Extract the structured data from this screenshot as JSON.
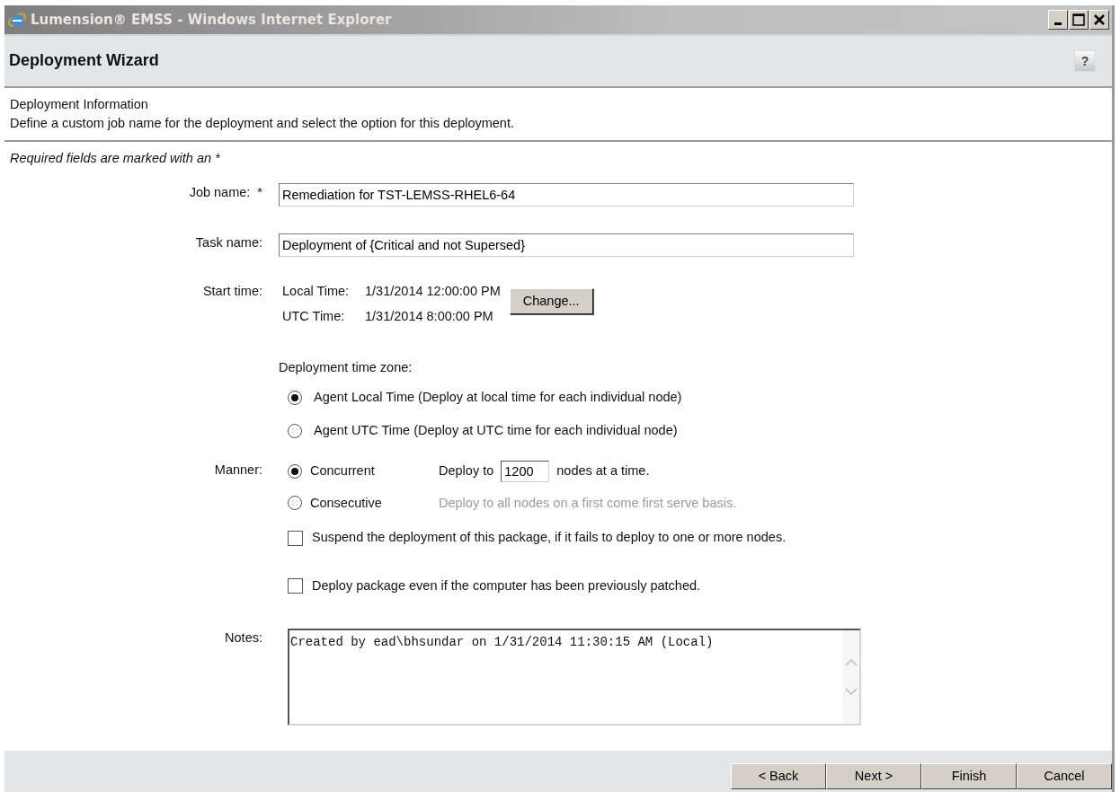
{
  "window": {
    "title": "Lumension® EMSS - Windows Internet Explorer"
  },
  "header": {
    "title": "Deployment Wizard",
    "help": "?"
  },
  "info": {
    "heading": "Deployment Information",
    "description": "Define a custom job name for the deployment and select the option for this deployment."
  },
  "required_note": "Required fields are marked with an *",
  "job_name": {
    "label": "Job name:",
    "required_mark": "*",
    "value": "Remediation for TST-LEMSS-RHEL6-64"
  },
  "task_name": {
    "label": "Task name:",
    "value": "Deployment of {Critical and not Supersed}"
  },
  "start_time": {
    "label": "Start time:",
    "local_label": "Local Time:",
    "local_value": "1/31/2014 12:00:00 PM",
    "utc_label": "UTC Time:",
    "utc_value": "1/31/2014 8:00:00 PM",
    "button": "Change..."
  },
  "time_zone": {
    "label": "Deployment time zone:",
    "options": [
      {
        "label": "Agent Local Time (Deploy at local time for each individual node)",
        "selected": true
      },
      {
        "label": "Agent UTC Time (Deploy at UTC time for each individual node)",
        "selected": false
      }
    ]
  },
  "manner": {
    "label": "Manner:",
    "options": [
      {
        "label": "Concurrent",
        "selected": true,
        "kind": "count",
        "prefix": "Deploy to",
        "value": "1200",
        "suffix": "nodes at a time."
      },
      {
        "label": "Consecutive",
        "selected": false,
        "kind": "text",
        "description": "Deploy to all nodes on a first come first serve basis."
      }
    ]
  },
  "options": [
    {
      "label": "Suspend the deployment of this package, if it fails to deploy to one or more nodes.",
      "checked": false
    },
    {
      "label": "Deploy package even if the computer has been previously patched.",
      "checked": false
    }
  ],
  "notes": {
    "label": "Notes:",
    "value": "Created by ead\\bhsundar on 1/31/2014 11:30:15 AM (Local)"
  },
  "buttons": [
    "< Back",
    "Next >",
    "Finish",
    "Cancel"
  ]
}
